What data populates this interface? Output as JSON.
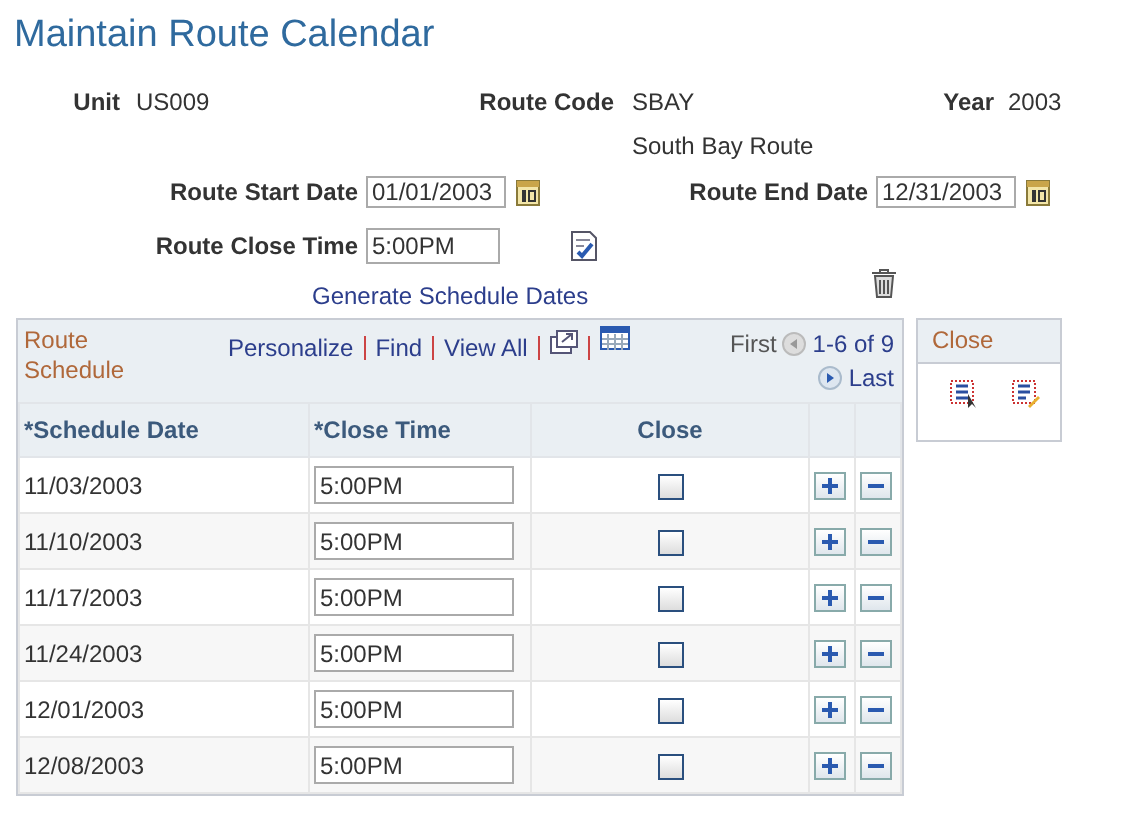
{
  "title": "Maintain Route Calendar",
  "header": {
    "unit": {
      "label": "Unit",
      "value": "US009"
    },
    "route_code": {
      "label": "Route Code",
      "value": "SBAY",
      "description": "South Bay Route"
    },
    "year": {
      "label": "Year",
      "value": "2003"
    }
  },
  "route_start_date": {
    "label": "Route Start Date",
    "value": "01/01/2003"
  },
  "route_end_date": {
    "label": "Route End Date",
    "value": "12/31/2003"
  },
  "route_close_time": {
    "label": "Route Close Time",
    "value": "5:00PM"
  },
  "generate_link": "Generate Schedule Dates",
  "grid": {
    "title": "Route Schedule",
    "links": [
      "Personalize",
      "Find",
      "View All"
    ],
    "first": "First",
    "range": "1-6 of 9",
    "last": "Last",
    "columns": [
      "*Schedule Date",
      "*Close Time",
      "Close"
    ],
    "rows": [
      {
        "date": "11/03/2003",
        "close_time": "5:00PM",
        "close": false
      },
      {
        "date": "11/10/2003",
        "close_time": "5:00PM",
        "close": false
      },
      {
        "date": "11/17/2003",
        "close_time": "5:00PM",
        "close": false
      },
      {
        "date": "11/24/2003",
        "close_time": "5:00PM",
        "close": false
      },
      {
        "date": "12/01/2003",
        "close_time": "5:00PM",
        "close": false
      },
      {
        "date": "12/08/2003",
        "close_time": "5:00PM",
        "close": false
      }
    ]
  },
  "close_panel": {
    "title": "Close"
  }
}
